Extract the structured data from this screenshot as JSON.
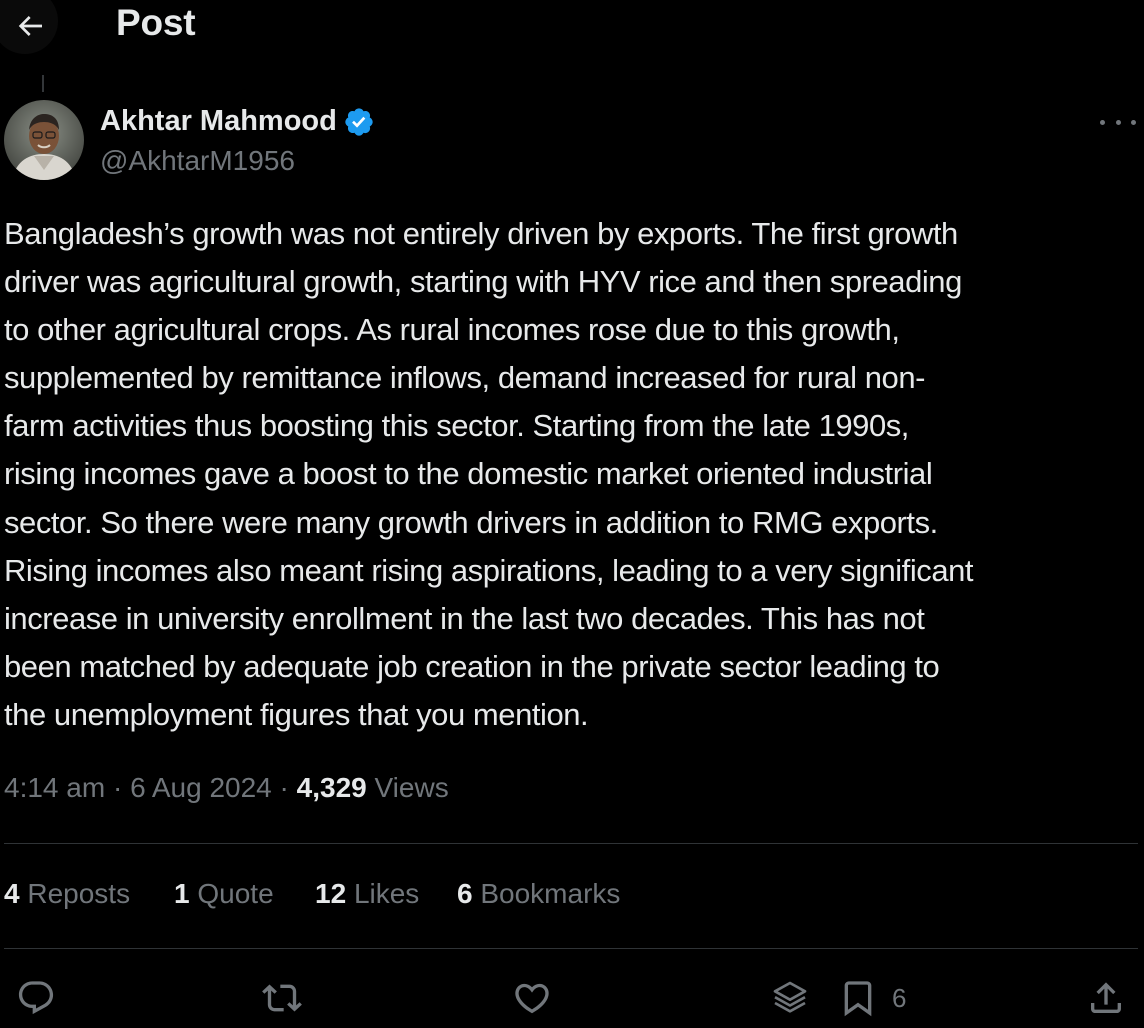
{
  "header": {
    "title": "Post",
    "back_icon": "arrow-left-icon"
  },
  "author": {
    "name": "Akhtar Mahmood",
    "handle": "@AkhtarM1956",
    "verified_color": "#1d9bf0"
  },
  "tweet": {
    "lines": [
      "Bangladesh’s growth was not entirely driven by exports. The first growth",
      "driver was agricultural growth, starting with HYV rice and then spreading",
      "to other agricultural crops. As rural incomes rose due to this growth,",
      "supplemented by remittance inflows, demand increased for rural non-",
      "farm activities thus boosting this sector. Starting from the late 1990s,",
      "rising incomes gave a boost to the domestic market oriented industrial",
      "sector. So there were many growth drivers in addition to RMG exports.",
      "Rising incomes also meant rising aspirations, leading to a very significant",
      "increase in university enrollment in the last two decades. This has not",
      "been matched by adequate job creation in the private sector leading to",
      "the unemployment figures that you mention."
    ],
    "time": "4:14 am",
    "separator": "·",
    "date": "6 Aug 2024",
    "views_count": "4,329",
    "views_label": "Views"
  },
  "stats": {
    "reposts": {
      "count": "4",
      "label": "Reposts"
    },
    "quotes": {
      "count": "1",
      "label": "Quote"
    },
    "likes": {
      "count": "12",
      "label": "Likes"
    },
    "bookmarks": {
      "count": "6",
      "label": "Bookmarks"
    }
  },
  "actions": {
    "reply_icon": "reply-icon",
    "repost_icon": "repost-icon",
    "like_icon": "heart-icon",
    "grok_icon": "layers-icon",
    "bookmark_icon": "bookmark-icon",
    "bookmark_count": "6",
    "share_icon": "share-icon"
  },
  "colors": {
    "background": "#000000",
    "text": "#e7e9ea",
    "muted": "#71767b",
    "divider": "#2f3336"
  }
}
